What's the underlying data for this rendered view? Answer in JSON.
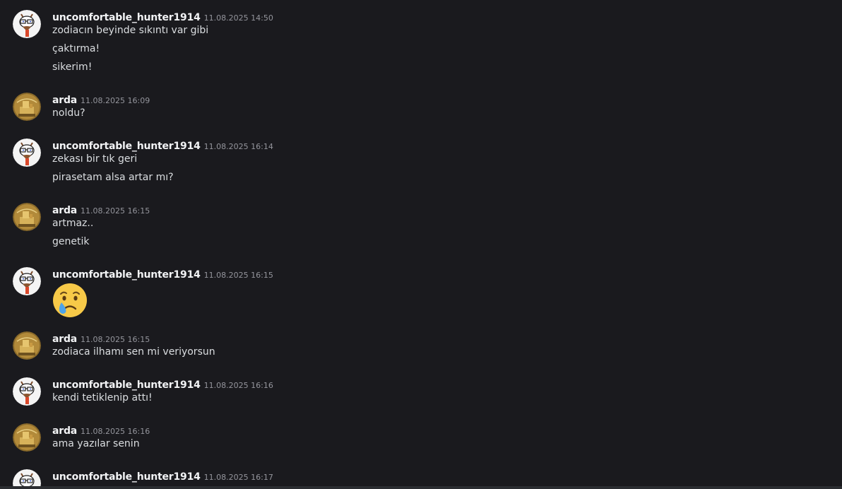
{
  "colors": {
    "background": "#1a1a1e",
    "username": "#f2f3f5",
    "timestamp": "#94959c",
    "message_text": "#dbdee1"
  },
  "messages": [
    {
      "avatar": "cartoon-goose-avatar",
      "author": "uncomfortable_hunter1914",
      "time": "11.08.2025 14:50",
      "lines": [
        "zodiacın beyinde sıkıntı var gibi",
        "çaktırma!",
        "sikerim!"
      ]
    },
    {
      "avatar": "golden-statue-avatar",
      "author": "arda",
      "time": "11.08.2025 16:09",
      "lines": [
        "noldu?"
      ]
    },
    {
      "avatar": "cartoon-goose-avatar",
      "author": "uncomfortable_hunter1914",
      "time": "11.08.2025 16:14",
      "lines": [
        "zekası bir tık geri",
        "pirasetam alsa artar mı?"
      ]
    },
    {
      "avatar": "golden-statue-avatar",
      "author": "arda",
      "time": "11.08.2025 16:15",
      "lines": [
        "artmaz..",
        "genetik"
      ]
    },
    {
      "avatar": "cartoon-goose-avatar",
      "author": "uncomfortable_hunter1914",
      "time": "11.08.2025 16:15",
      "emoji": "crying-face-emoji"
    },
    {
      "avatar": "golden-statue-avatar",
      "author": "arda",
      "time": "11.08.2025 16:15",
      "lines": [
        "zodiaca ilhamı sen mi veriyorsun"
      ]
    },
    {
      "avatar": "cartoon-goose-avatar",
      "author": "uncomfortable_hunter1914",
      "time": "11.08.2025 16:16",
      "lines": [
        "kendi tetiklenip attı!"
      ]
    },
    {
      "avatar": "golden-statue-avatar",
      "author": "arda",
      "time": "11.08.2025 16:16",
      "lines": [
        "ama yazılar senin"
      ]
    },
    {
      "avatar": "cartoon-goose-avatar",
      "author": "uncomfortable_hunter1914",
      "time": "11.08.2025 16:17",
      "lines": []
    }
  ]
}
